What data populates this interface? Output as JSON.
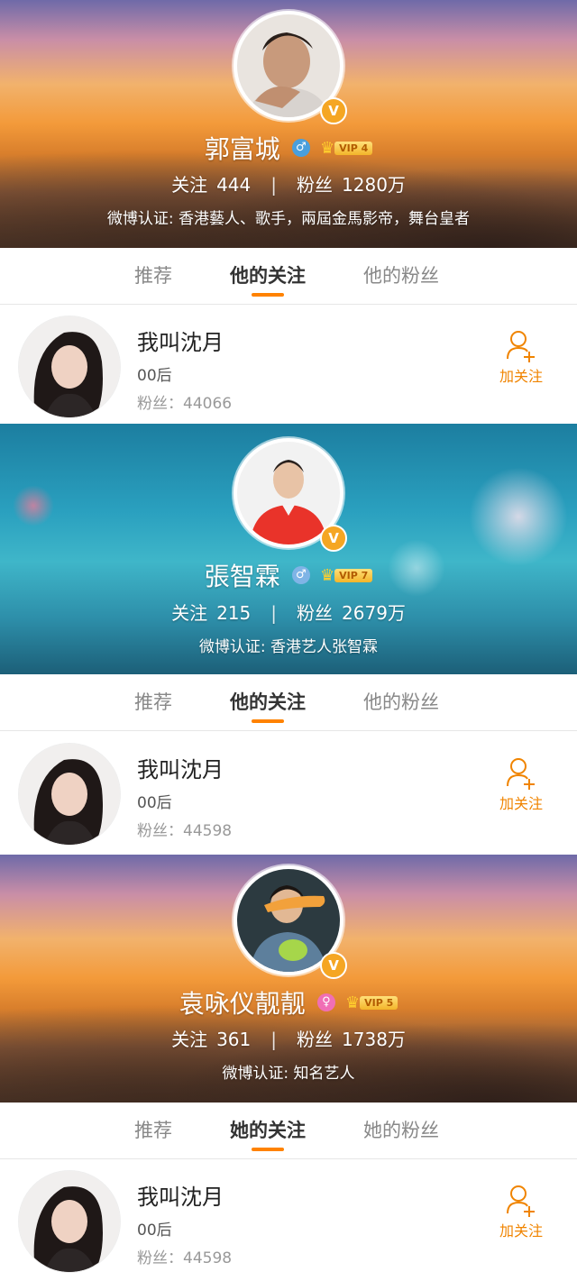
{
  "colors": {
    "accent": "#ff8200",
    "follow": "#f08400",
    "male": "#4a9fdc",
    "female": "#f06fb5",
    "verify_badge": "#f5a623"
  },
  "cards": [
    {
      "name": "郭富城",
      "gender_icon": "♂",
      "vip": "VIP 4",
      "following_label": "关注",
      "following": "444",
      "fans_label": "粉丝",
      "fans": "1280万",
      "verification": "微博认证: 香港藝人、歌手，兩屆金馬影帝，舞台皇者",
      "tabs": [
        "推荐",
        "他的关注",
        "他的粉丝"
      ],
      "row": {
        "name": "我叫沈月",
        "bio": "00后",
        "fans": "粉丝：44066",
        "follow_label": "加关注"
      }
    },
    {
      "name": "張智霖",
      "gender_icon": "♂",
      "vip": "VIP 7",
      "following_label": "关注",
      "following": "215",
      "fans_label": "粉丝",
      "fans": "2679万",
      "verification": "微博认证: 香港艺人张智霖",
      "tabs": [
        "推荐",
        "他的关注",
        "他的粉丝"
      ],
      "row": {
        "name": "我叫沈月",
        "bio": "00后",
        "fans": "粉丝：44598",
        "follow_label": "加关注"
      }
    },
    {
      "name": "袁咏仪靓靓",
      "gender_icon": "♀",
      "vip": "VIP 5",
      "following_label": "关注",
      "following": "361",
      "fans_label": "粉丝",
      "fans": "1738万",
      "verification": "微博认证: 知名艺人",
      "tabs": [
        "推荐",
        "她的关注",
        "她的粉丝"
      ],
      "row": {
        "name": "我叫沈月",
        "bio": "00后",
        "fans": "粉丝：44598",
        "follow_label": "加关注"
      }
    }
  ]
}
